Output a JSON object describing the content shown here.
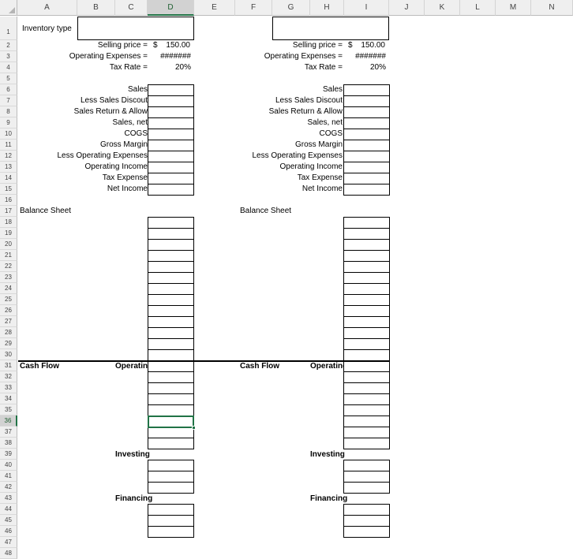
{
  "columns": [
    "A",
    "B",
    "C",
    "D",
    "E",
    "F",
    "G",
    "H",
    "I",
    "J",
    "K",
    "L",
    "M",
    "N"
  ],
  "selected_column": "D",
  "rows": [
    "1",
    "2",
    "3",
    "4",
    "5",
    "6",
    "7",
    "8",
    "9",
    "10",
    "11",
    "12",
    "13",
    "14",
    "15",
    "16",
    "17",
    "18",
    "19",
    "20",
    "21",
    "22",
    "23",
    "24",
    "25",
    "26",
    "27",
    "28",
    "29",
    "30",
    "31",
    "32",
    "33",
    "34",
    "35",
    "36",
    "37",
    "38",
    "39",
    "40",
    "41",
    "42",
    "43",
    "44",
    "45",
    "46",
    "47",
    "48"
  ],
  "selected_row": "36",
  "left": {
    "inventory_label": "Inventory type",
    "selling_price_label": "Selling price =",
    "selling_price_currency": "$",
    "selling_price_value": "150.00",
    "opex_label": "Operating Expenses =",
    "opex_value": "#######",
    "tax_rate_label": "Tax Rate =",
    "tax_rate_value": "20%",
    "income_items": [
      "Sales",
      "Less Sales Discout",
      "Sales Return & Allow",
      "Sales, net",
      "COGS",
      "Gross Margin",
      "Less Operating Expenses",
      "Operating Income",
      "Tax Expense",
      "Net Income"
    ],
    "balance_sheet_label": "Balance Sheet",
    "cash_flow_label": "Cash Flow",
    "operating_label": "Operating",
    "investing_label": "Investing",
    "financing_label": "Financing"
  },
  "right": {
    "selling_price_label": "Selling price =",
    "selling_price_currency": "$",
    "selling_price_value": "150.00",
    "opex_label": "Operating Expenses =",
    "opex_value": "#######",
    "tax_rate_label": "Tax Rate =",
    "tax_rate_value": "20%",
    "income_items": [
      "Sales",
      "Less Sales Discout",
      "Sales Return & Allow",
      "Sales, net",
      "COGS",
      "Gross Margin",
      "Less Operating Expenses",
      "Operating Income",
      "Tax Expense",
      "Net Income"
    ],
    "balance_sheet_label": "Balance Sheet",
    "cash_flow_label": "Cash Flow",
    "operating_label": "Operating",
    "investing_label": "Investing",
    "financing_label": "Financing"
  }
}
